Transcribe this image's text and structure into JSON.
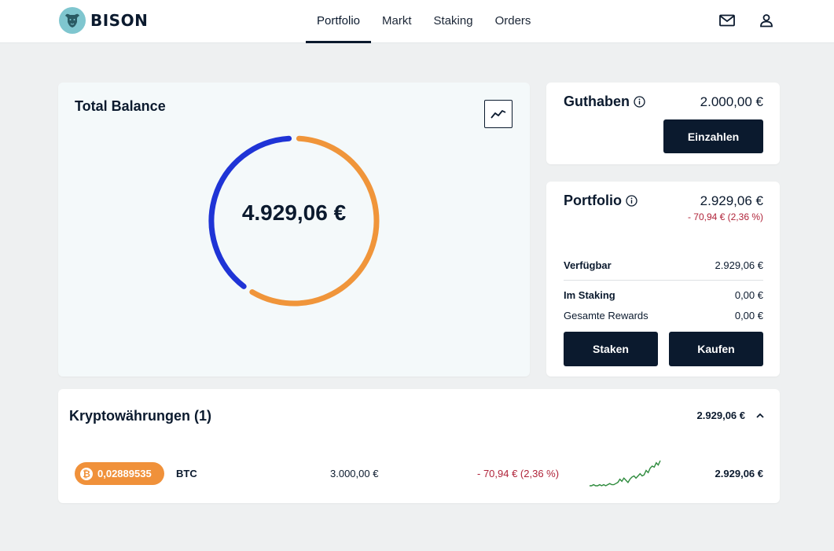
{
  "brand": {
    "name": "BISON",
    "accent": "#0b1a2e",
    "teal": "#7fc6cf"
  },
  "nav": {
    "items": [
      {
        "label": "Portfolio",
        "active": true
      },
      {
        "label": "Markt",
        "active": false
      },
      {
        "label": "Staking",
        "active": false
      },
      {
        "label": "Orders",
        "active": false
      }
    ],
    "icons": [
      "mail-icon",
      "user-icon"
    ]
  },
  "total_balance": {
    "title": "Total Balance",
    "value": "4.929,06 €",
    "segments": [
      {
        "asset": "Guthaben",
        "amount": 2000.0,
        "color": "#1f34d6"
      },
      {
        "asset": "Portfolio",
        "amount": 2929.06,
        "color": "#f0953a"
      }
    ]
  },
  "guthaben": {
    "title": "Guthaben",
    "amount": "2.000,00 €",
    "button": "Einzahlen"
  },
  "portfolio": {
    "title": "Portfolio",
    "amount": "2.929,06 €",
    "change": "- 70,94 € (2,36 %)",
    "rows": [
      {
        "label": "Verfügbar",
        "value": "2.929,06 €"
      },
      {
        "label": "Im Staking",
        "value": "0,00 €"
      },
      {
        "label": "Gesamte Rewards",
        "value": "0,00 €"
      }
    ],
    "buttons": {
      "stake": "Staken",
      "buy": "Kaufen"
    }
  },
  "crypto": {
    "title": "Kryptowährungen (1)",
    "total": "2.929,06 €",
    "assets": [
      {
        "amount": "0,02889535",
        "symbol": "BTC",
        "icon_glyph": "₿",
        "invested": "3.000,00 €",
        "change": "- 70,94 € (2,36 %)",
        "value": "2.929,06 €",
        "sparkline": [
          10,
          10,
          11,
          10,
          10,
          11,
          10,
          11,
          10,
          11,
          12,
          11,
          11,
          12,
          13,
          16,
          14,
          17,
          15,
          13,
          16,
          18,
          19,
          17,
          19,
          21,
          19,
          20,
          24,
          22,
          26,
          28,
          27,
          31,
          29,
          33
        ]
      }
    ]
  }
}
